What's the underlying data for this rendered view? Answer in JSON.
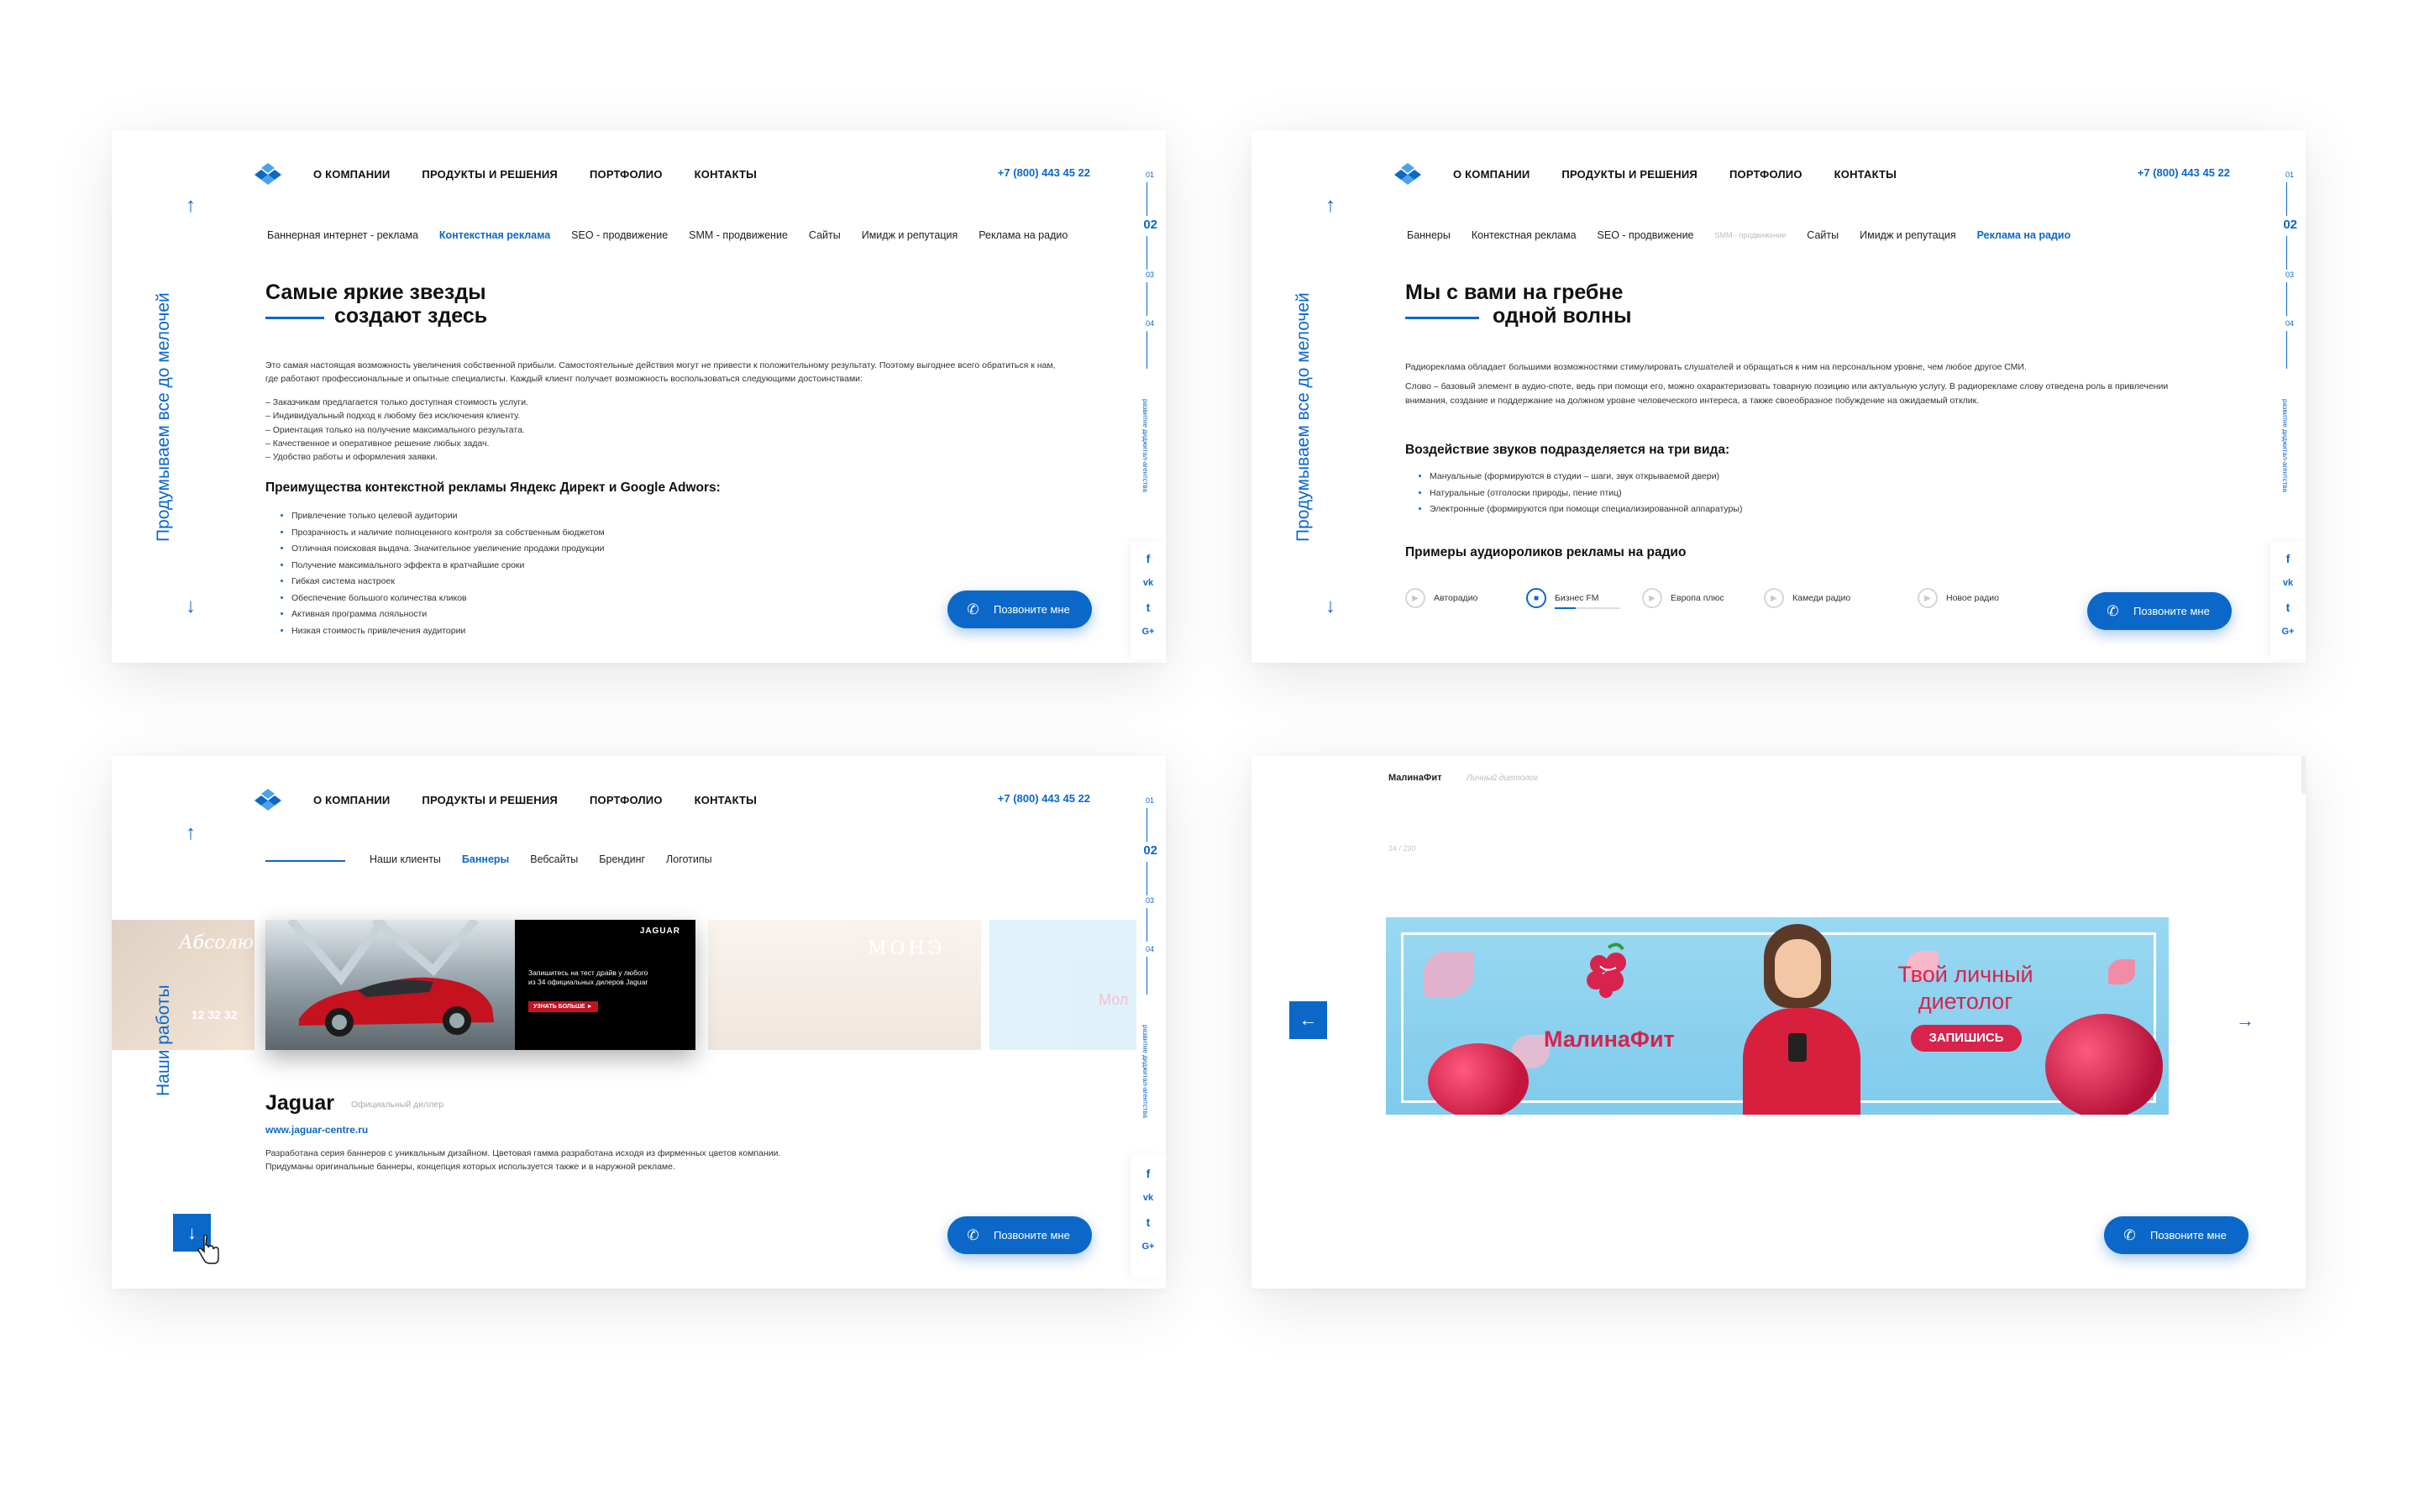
{
  "nav": {
    "items": [
      "О КОМПАНИИ",
      "ПРОДУКТЫ И РЕШЕНИЯ",
      "ПОРТФОЛИО",
      "КОНТАКТЫ"
    ],
    "phone": "+7 (800) 443 45 22"
  },
  "side": {
    "nums": [
      "01",
      "02",
      "03",
      "04"
    ],
    "active": "02",
    "footer": "развитие диджитал-агентства",
    "social": [
      "f",
      "vk",
      "t",
      "G+"
    ]
  },
  "call_button": "Позвоните мне",
  "vertical": {
    "details": "Продумываем все до мелочей",
    "works": "Наши работы"
  },
  "panel1": {
    "tabs": [
      "Баннерная интернет - реклама",
      "Контекстная реклама",
      "SEO - продвижение",
      "SMM - продвижение",
      "Сайты",
      "Имидж и репутация",
      "Реклама на радио"
    ],
    "active_tab": "Контекстная реклама",
    "title_1": "Самые яркие звезды",
    "title_2": "создают здесь",
    "intro_1": "Это самая настоящая возможность увеличения собственной прибыли. Самостоятельные действия могут не привести к положительному результату. Поэтому выгоднее всего обратиться к нам,",
    "intro_2": "где работают профессиональные и опытные специалисты. Каждый клиент получает возможность воспользоваться следующими достоинствами:",
    "dashes": [
      "– Заказчикам предлагается только доступная стоимость услуги.",
      "– Индивидуальный подход к любому без исключения клиенту.",
      "– Ориентация только на получение максимального результата.",
      "– Качественное и оперативное решение любых задач.",
      "– Удобство работы и оформления заявки."
    ],
    "subtitle": "Преимущества контекстной рекламы Яндекс Директ и Google Adwors:",
    "bullets": [
      "Привлечение только целевой аудитории",
      "Прозрачность и наличие полноценного контроля за собственным бюджетом",
      "Отличная поисковая выдача. Значительное увеличение продажи продукции",
      "Получение максимального эффекта в кратчайшие сроки",
      "Гибкая система настроек",
      "Обеспечение большого количества кликов",
      "Активная программа лояльности",
      "Низкая стоимость привлечения аудитории"
    ]
  },
  "panel2": {
    "tabs": [
      "Баннеры",
      "Контекстная реклама",
      "SEO - продвижение",
      "SMM - продвижение",
      "Сайты",
      "Имидж и репутация",
      "Реклама на радио"
    ],
    "active_tab": "Реклама на радио",
    "title_1": "Мы с вами на гребне",
    "title_2": "одной волны",
    "para_1": "Радиореклама обладает большими возможностями стимулировать слушателей и обращаться к ним на персональном уровне, чем любое другое СМИ.",
    "para_2": "Слово – базовый элемент в аудио-спотe, ведь при помощи его, можно охарактеризовать товарную позицию или актуальную услугу. В радиорекламе слову отведена роль в привлечении",
    "para_3": "внимания, создание и поддержание на должном уровне человеческого интереса, а также своеобразное побуждение на ожидаемый отклик.",
    "subtitle": "Воздействие звуков подразделяется на три вида:",
    "bullets": [
      "Мануальные (формируются в студии – шаги, звук открываемой двери)",
      "Натуральные (отголоски природы, пение птиц)",
      "Электронные (формируются при помощи специализированной аппаратуры)"
    ],
    "examples_title": "Примеры аудиороликов рекламы на радио",
    "stations": [
      "Авторадио",
      "Бизнес FM",
      "Европа плюс",
      "Камеди радио",
      "Новое радио"
    ],
    "playing": "Бизнес FM"
  },
  "panel3": {
    "tabs": [
      "Наши клиенты",
      "Баннеры",
      "Вебсайты",
      "Брендинг",
      "Логотипы"
    ],
    "active_tab": "Баннеры",
    "client": "Jaguar",
    "client_role": "Официальный диллер",
    "url": "www.jaguar-centre.ru",
    "desc_1": "Разработана серия баннеров с уникальным дизайном. Цветовая гамма разработана исходя из фирменных цветов компании.",
    "desc_2": "Придуманы оригинальные баннеры, концепция которых используется также и в наружной рекламе.",
    "banner_text": "Запишитесь на тест драйв у любого из 34 официальных дилеров Jaguar",
    "banner_btn": "УЗНАТЬ БОЛЬШЕ ►",
    "banner_brand": "JAGUAR",
    "thumb_left": "Абсолют",
    "thumb_left_time": "12 32 32",
    "thumb_right": "МОНЭ",
    "thumb_far": "Мол"
  },
  "panel4": {
    "breadcrumb_1": "МалинаФит",
    "breadcrumb_2": "Личный диетолог",
    "counter": "34 / 230",
    "brand": "МалинаФит",
    "headline_1": "Твой личный",
    "headline_2": "диетолог",
    "cta": "ЗАПИШИСЬ"
  },
  "colors": {
    "accent": "#0b68c9",
    "banner_bg": "#8fd3f0",
    "raspberry": "#d8234d"
  }
}
